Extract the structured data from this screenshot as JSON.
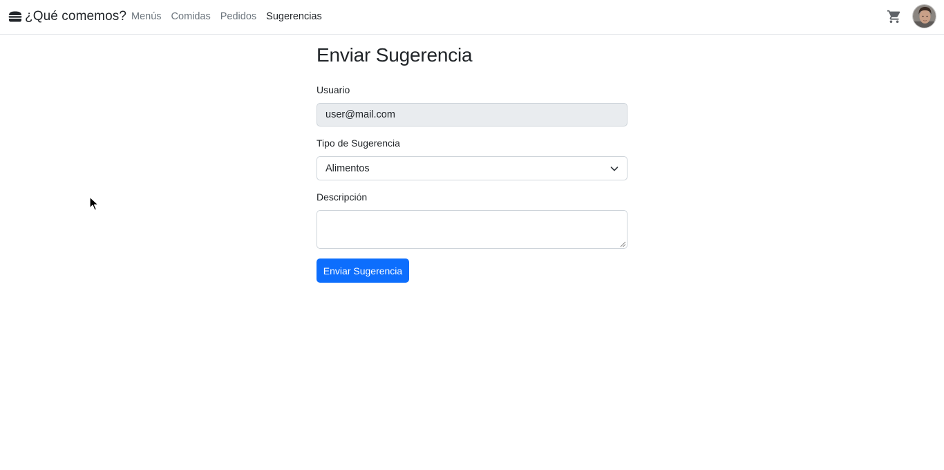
{
  "navbar": {
    "brand_icon": "burger-icon",
    "brand": "¿Qué comemos?",
    "links": [
      {
        "label": "Menús",
        "active": false
      },
      {
        "label": "Comidas",
        "active": false
      },
      {
        "label": "Pedidos",
        "active": false
      },
      {
        "label": "Sugerencias",
        "active": true
      }
    ],
    "cart_icon": "cart-icon",
    "avatar_icon": "user-avatar"
  },
  "form": {
    "title": "Enviar Sugerencia",
    "user": {
      "label": "Usuario",
      "value": "user@mail.com"
    },
    "type": {
      "label": "Tipo de Sugerencia",
      "selected": "Alimentos"
    },
    "description": {
      "label": "Descripción",
      "value": ""
    },
    "submit_label": "Enviar Sugerencia"
  },
  "colors": {
    "primary": "#0d6efd",
    "muted_link": "#6c757d",
    "disabled_bg": "#e9ecef",
    "border": "#ced4da"
  }
}
